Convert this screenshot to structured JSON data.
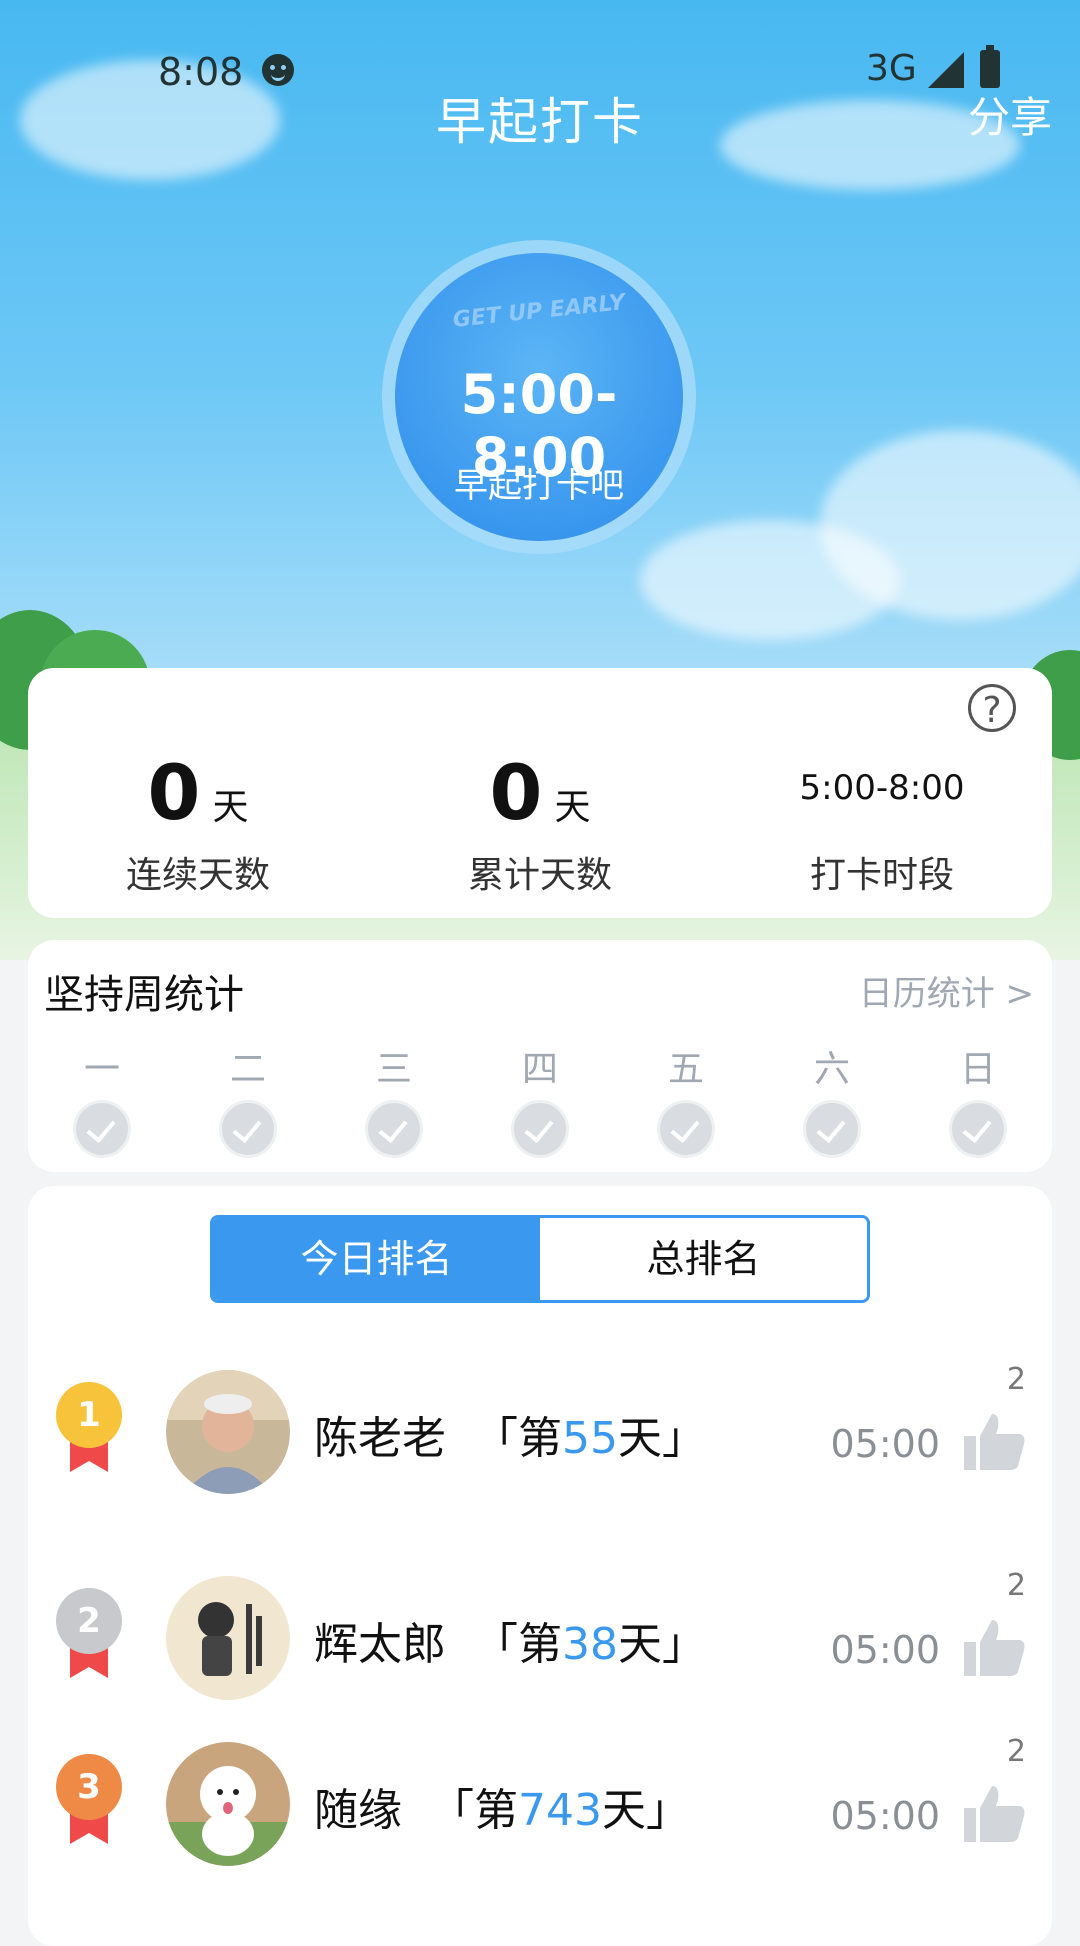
{
  "status_bar": {
    "time": "8:08",
    "network": "3G"
  },
  "header": {
    "title": "早起打卡",
    "share_label": "分享"
  },
  "clock": {
    "logo": "GET UP EARLY",
    "time_range": "5:00-8:00",
    "subtitle": "早起打卡吧"
  },
  "stats": {
    "help": "?",
    "consecutive": {
      "value": "0",
      "unit": "天",
      "label": "连续天数"
    },
    "total": {
      "value": "0",
      "unit": "天",
      "label": "累计天数"
    },
    "period": {
      "value": "5:00-8:00",
      "label": "打卡时段"
    }
  },
  "week": {
    "title": "坚持周统计",
    "calendar_link": "日历统计 >",
    "days": [
      "一",
      "二",
      "三",
      "四",
      "五",
      "六",
      "日"
    ]
  },
  "ranking": {
    "tabs": [
      "今日排名",
      "总排名"
    ],
    "active_tab": 0,
    "rows": [
      {
        "rank": "1",
        "name": "陈老老",
        "prefix": "「第",
        "days": "55",
        "suffix": "天」",
        "time": "05:00",
        "likes": "2",
        "medal_color": "#f6c33a"
      },
      {
        "rank": "2",
        "name": "辉太郎",
        "prefix": "「第",
        "days": "38",
        "suffix": "天」",
        "time": "05:00",
        "likes": "2",
        "medal_color": "#c7c9cc"
      },
      {
        "rank": "3",
        "name": "随缘",
        "prefix": "「第",
        "days": "743",
        "suffix": "天」",
        "time": "05:00",
        "likes": "2",
        "medal_color": "#ee8a45"
      }
    ]
  },
  "colors": {
    "accent": "#3a98ee",
    "medal_ribbon": "#ef4a49"
  }
}
